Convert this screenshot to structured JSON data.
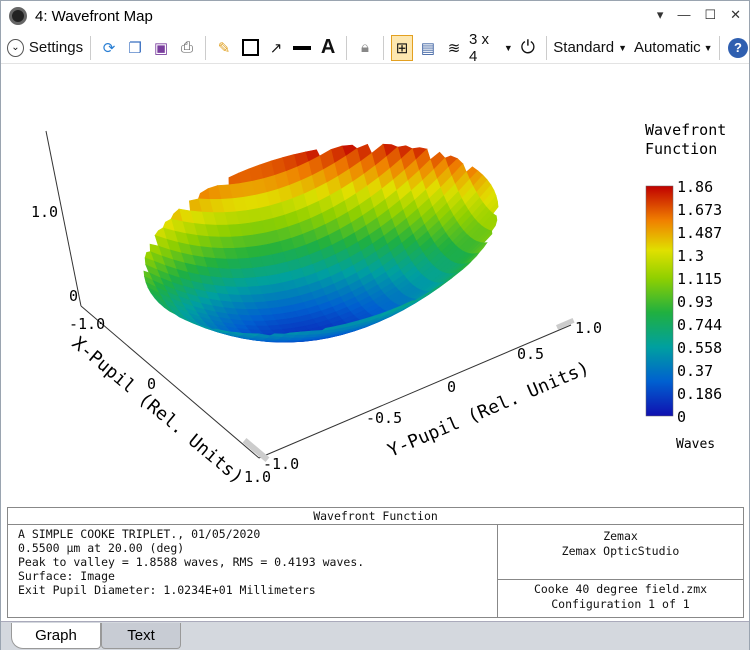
{
  "window": {
    "title": "4: Wavefront Map",
    "controls": [
      "▾",
      "—",
      "☐",
      "✕"
    ]
  },
  "toolbar": {
    "settings_label": "Settings",
    "layout_label": "3 x 4",
    "standard_label": "Standard",
    "automatic_label": "Automatic",
    "icons": [
      "refresh-icon",
      "copy-icon",
      "save-icon",
      "print-icon",
      "pencil-icon",
      "rectangle-icon",
      "arrow-icon",
      "line-icon",
      "text-icon",
      "lock-icon",
      "fit-icon",
      "window-icon",
      "layers-icon",
      "rotate-icon",
      "help-icon"
    ]
  },
  "chart_data": {
    "type": "surface3d",
    "x_axis_label": "X-Pupil (Rel. Units)",
    "y_axis_label": "Y-Pupil (Rel. Units)",
    "x_ticks": [
      "-1.0",
      "0",
      "1.0"
    ],
    "y_ticks": [
      "-1.0",
      "-0.5",
      "0",
      "0.5",
      "1.0"
    ],
    "z_ticks": [
      "0",
      "1.0"
    ],
    "legend_title": [
      "Wavefront",
      "Function"
    ],
    "colorbar_ticks": [
      "1.86",
      "1.673",
      "1.487",
      "1.3",
      "1.115",
      "0.93",
      "0.744",
      "0.558",
      "0.37",
      "0.186",
      "0"
    ],
    "colorbar_unit": "Waves",
    "zlim": [
      0,
      1.86
    ]
  },
  "info": {
    "header": "Wavefront Function",
    "lines": [
      "A SIMPLE COOKE TRIPLET., 01/05/2020",
      "0.5500 µm at 20.00 (deg)",
      "Peak to valley = 1.8588 waves, RMS = 0.4193 waves.",
      "Surface: Image",
      "Exit Pupil Diameter: 1.0234E+01 Millimeters"
    ],
    "company": [
      "Zemax",
      "Zemax OpticStudio"
    ],
    "file": [
      "Cooke 40 degree field.zmx",
      "Configuration 1 of 1"
    ]
  },
  "tabs": [
    {
      "label": "Graph",
      "active": true
    },
    {
      "label": "Text",
      "active": false
    }
  ]
}
